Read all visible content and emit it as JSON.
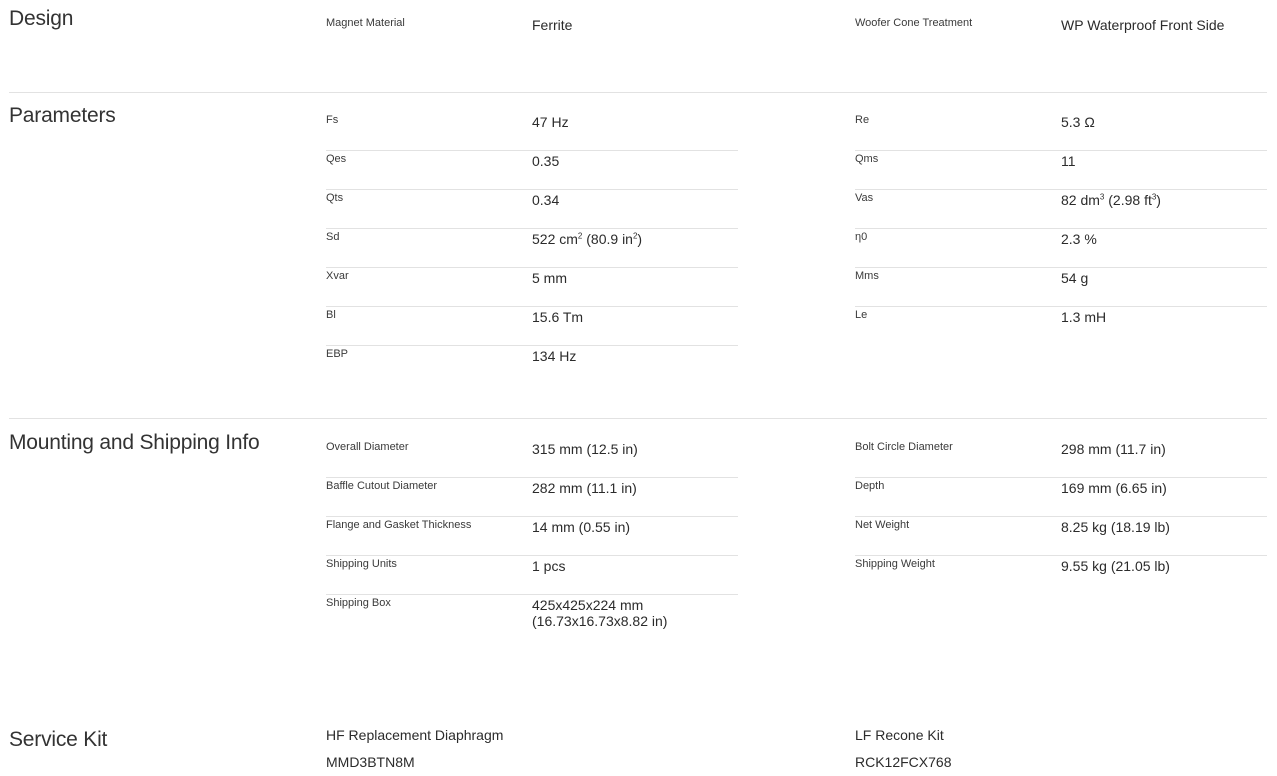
{
  "design": {
    "title": "Design",
    "left": [
      {
        "label": "Magnet Material",
        "value": "Ferrite"
      }
    ],
    "right": [
      {
        "label": "Woofer Cone Treatment",
        "value": "WP Waterproof Front Side"
      }
    ]
  },
  "parameters": {
    "title": "Parameters",
    "left": [
      {
        "label": "Fs",
        "value": "47 Hz"
      },
      {
        "label": "Qes",
        "value": "0.35"
      },
      {
        "label": "Qts",
        "value": "0.34"
      },
      {
        "label": "Sd",
        "value": "522 cm",
        "sup1": "2",
        "mid": " (80.9 in",
        "sup2": "2",
        "end": ")"
      },
      {
        "label": "Xvar",
        "value": "5 mm"
      },
      {
        "label": "Bl",
        "value": "15.6 Tm"
      },
      {
        "label": "EBP",
        "value": "134 Hz"
      }
    ],
    "right": [
      {
        "label": "Re",
        "value": "5.3 Ω"
      },
      {
        "label": "Qms",
        "value": "11"
      },
      {
        "label": "Vas",
        "value": "82 dm",
        "sup1": "3",
        "mid": " (2.98 ft",
        "sup2": "3",
        "end": ")"
      },
      {
        "label": "η0",
        "value": "2.3 %"
      },
      {
        "label": "Mms",
        "value": "54 g"
      },
      {
        "label": "Le",
        "value": "1.3 mH"
      }
    ]
  },
  "mounting": {
    "title": "Mounting and Shipping Info",
    "left": [
      {
        "label": "Overall Diameter",
        "value": "315 mm (12.5 in)"
      },
      {
        "label": "Baffle Cutout Diameter",
        "value": "282 mm (11.1 in)"
      },
      {
        "label": "Flange and Gasket Thickness",
        "value": "14 mm (0.55 in)"
      },
      {
        "label": "Shipping Units",
        "value": "1 pcs"
      },
      {
        "label": "Shipping Box",
        "value": "425x425x224 mm",
        "value2": "(16.73x16.73x8.82 in)"
      }
    ],
    "right": [
      {
        "label": "Bolt Circle Diameter",
        "value": "298 mm (11.7 in)"
      },
      {
        "label": "Depth",
        "value": "169 mm (6.65 in)"
      },
      {
        "label": "Net Weight",
        "value": "8.25 kg (18.19 lb)"
      },
      {
        "label": "Shipping Weight",
        "value": "9.55 kg (21.05 lb)"
      }
    ]
  },
  "service_kit": {
    "title": "Service Kit",
    "left": {
      "label": "HF Replacement Diaphragm",
      "value": "MMD3BTN8M"
    },
    "right": {
      "label": "LF Recone Kit",
      "value": "RCK12FCX768"
    }
  }
}
